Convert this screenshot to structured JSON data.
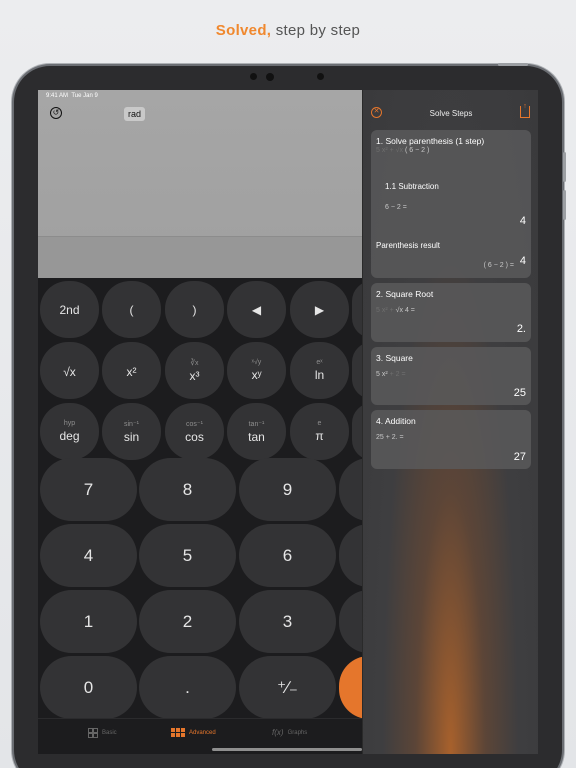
{
  "headline": {
    "accent": "Solved,",
    "rest": " step by step"
  },
  "status": {
    "time": "9:41 AM",
    "date": "Tue Jan 9",
    "icons": "▮▮▮ ◠ ▬"
  },
  "display": {
    "mode": "rad",
    "history_icon": "history-icon"
  },
  "keys": {
    "row1": [
      "2nd",
      "(",
      ")",
      "◀",
      "▶"
    ],
    "row2": [
      {
        "sub": "",
        "main": "√x"
      },
      {
        "sub": "",
        "main": "x²"
      },
      {
        "sub": "∛x",
        "main": "x³"
      },
      {
        "sub": "ˣ√y",
        "main": "xʸ"
      },
      {
        "sub": "eˣ",
        "main": "ln"
      }
    ],
    "row3": [
      {
        "sub": "hyp",
        "main": "deg"
      },
      {
        "sub": "sin⁻¹",
        "main": "sin"
      },
      {
        "sub": "cos⁻¹",
        "main": "cos"
      },
      {
        "sub": "tan⁻¹",
        "main": "tan"
      },
      {
        "sub": "e",
        "main": "π"
      }
    ],
    "numbers": [
      "7",
      "8",
      "9",
      "4",
      "5",
      "6",
      "1",
      "2",
      "3",
      "0",
      ".",
      "⁺∕₋"
    ]
  },
  "tabs": [
    {
      "label": "Basic",
      "icon": "grid-icon"
    },
    {
      "label": "Advanced",
      "icon": "keypad-icon"
    },
    {
      "label": "Graphs",
      "icon": "function-icon",
      "glyph": "f(x)"
    }
  ],
  "panel": {
    "title": "Solve Steps",
    "steps": [
      {
        "title": "1. Solve parenthesis (1 step)",
        "formula_dim": "5 x² + √x",
        "formula": "( 6 − 2 )",
        "sub_title": "1.1 Subtraction",
        "sub_formula": "6 − 2 =",
        "sub_result": "4",
        "extra_title": "Parenthesis result",
        "extra_formula": "( 6 − 2 ) =",
        "extra_result": "4"
      },
      {
        "title": "2. Square Root",
        "formula_dim": "5 x² +",
        "formula": "√x 4 =",
        "result": "2."
      },
      {
        "title": "3. Square",
        "formula": "5 x²",
        "formula_dim": "+ 2 =",
        "result": "25"
      },
      {
        "title": "4. Addition",
        "formula": "25 + 2. =",
        "result": "27"
      }
    ]
  },
  "colors": {
    "accent": "#e5762c",
    "background": "#e6e8eb",
    "panel": "#3a3a3c"
  }
}
